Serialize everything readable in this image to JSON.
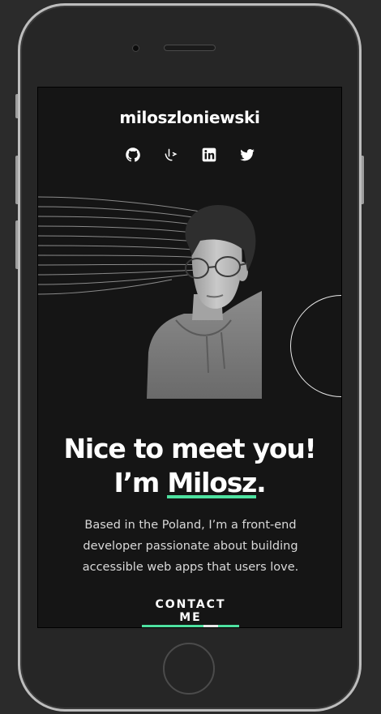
{
  "site": {
    "title": "miloszloniewski"
  },
  "socials": [
    {
      "name": "github-icon",
      "label": "GitHub"
    },
    {
      "name": "frontend-mentor-icon",
      "label": "Frontend Mentor"
    },
    {
      "name": "linkedin-icon",
      "label": "LinkedIn"
    },
    {
      "name": "twitter-icon",
      "label": "Twitter"
    }
  ],
  "hero": {
    "line1": "Nice to meet you!",
    "line2_prefix": "I’m ",
    "name": "Milosz",
    "line2_suffix": ".",
    "bio": "Based in the Poland, I’m a front-end developer passionate about building accessible web apps that users love."
  },
  "cta": {
    "label": "CONTACT ME"
  },
  "colors": {
    "accent": "#4ee1a0",
    "background": "#151515",
    "text": "#ffffff",
    "muted": "#d9d9d9"
  }
}
